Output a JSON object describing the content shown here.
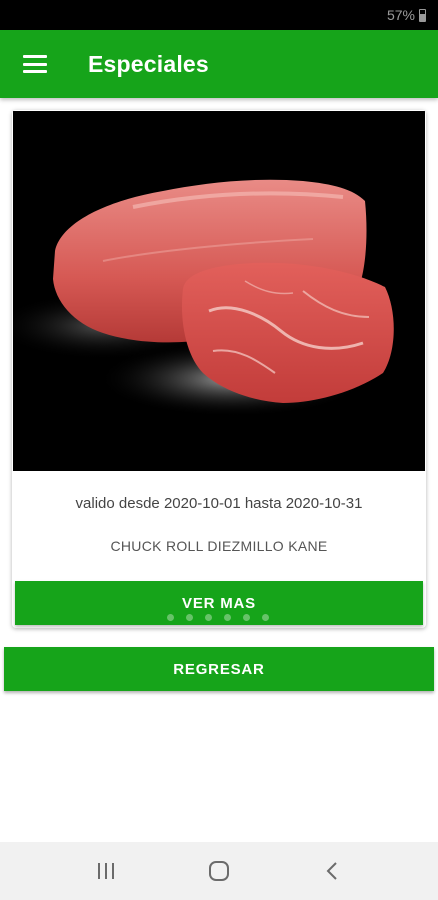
{
  "status_bar": {
    "battery": "57%"
  },
  "app_bar": {
    "title": "Especiales"
  },
  "special": {
    "validity": "valido desde 2020-10-01 hasta 2020-10-31",
    "product_name": "CHUCK ROLL DIEZMILLO KANE",
    "button_label": "VER MAS"
  },
  "back_button_label": "REGRESAR",
  "icons": {
    "menu": "hamburger-menu-icon",
    "battery": "battery-icon",
    "recents": "recents-icon",
    "home": "home-icon",
    "back": "back-icon"
  },
  "colors": {
    "primary": "#16a41a",
    "image_background": "#000000"
  }
}
